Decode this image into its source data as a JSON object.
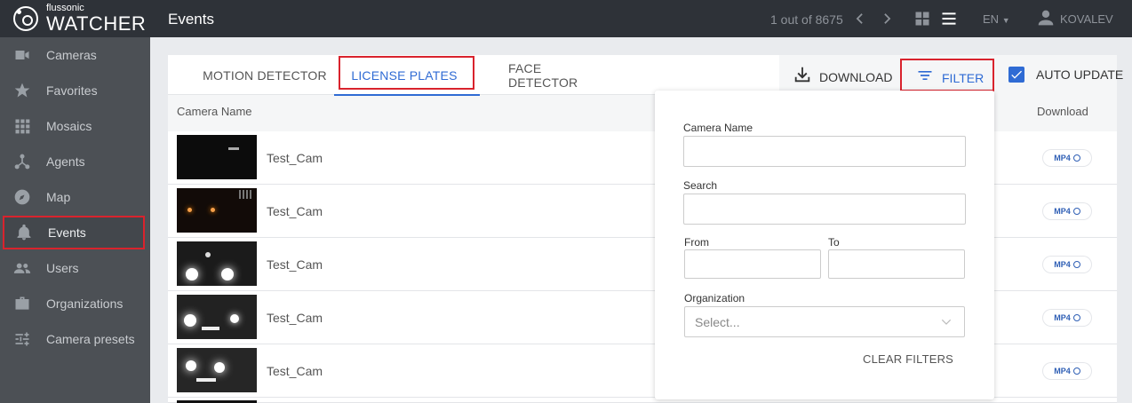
{
  "brand": {
    "sub": "flussonic",
    "main": "WATCHER"
  },
  "sidebar": {
    "items": [
      {
        "label": "Cameras",
        "icon": "camera-icon"
      },
      {
        "label": "Favorites",
        "icon": "star-icon"
      },
      {
        "label": "Mosaics",
        "icon": "grid-icon"
      },
      {
        "label": "Agents",
        "icon": "agents-icon"
      },
      {
        "label": "Map",
        "icon": "compass-icon"
      },
      {
        "label": "Events",
        "icon": "bell-icon"
      },
      {
        "label": "Users",
        "icon": "users-icon"
      },
      {
        "label": "Organizations",
        "icon": "briefcase-icon"
      },
      {
        "label": "Camera presets",
        "icon": "sliders-icon"
      }
    ],
    "active": "Events"
  },
  "header": {
    "title": "Events",
    "pager": "1 out of 8675",
    "language": "EN",
    "user": "KOVALEV"
  },
  "tabs": [
    {
      "label": "MOTION DETECTOR"
    },
    {
      "label": "LICENSE PLATES"
    },
    {
      "label": "FACE DETECTOR"
    }
  ],
  "active_tab": "LICENSE PLATES",
  "actions": {
    "download": "DOWNLOAD",
    "filter": "FILTER",
    "auto_update": "AUTO UPDATE",
    "auto_update_checked": true
  },
  "table": {
    "columns": {
      "camera": "Camera Name",
      "download": "Download"
    },
    "rows": [
      {
        "camera": "Test_Cam",
        "format": "MP4"
      },
      {
        "camera": "Test_Cam",
        "format": "MP4"
      },
      {
        "camera": "Test_Cam",
        "format": "MP4"
      },
      {
        "camera": "Test_Cam",
        "format": "MP4"
      },
      {
        "camera": "Test_Cam",
        "format": "MP4"
      }
    ]
  },
  "filter": {
    "camera_name_label": "Camera Name",
    "search_label": "Search",
    "from_label": "From",
    "to_label": "To",
    "organization_label": "Organization",
    "organization_placeholder": "Select...",
    "clear": "CLEAR FILTERS"
  },
  "colors": {
    "accent": "#2f6bd4",
    "highlight": "#d9232d",
    "sidebar": "#4c5055",
    "topbar": "#2e3238"
  }
}
